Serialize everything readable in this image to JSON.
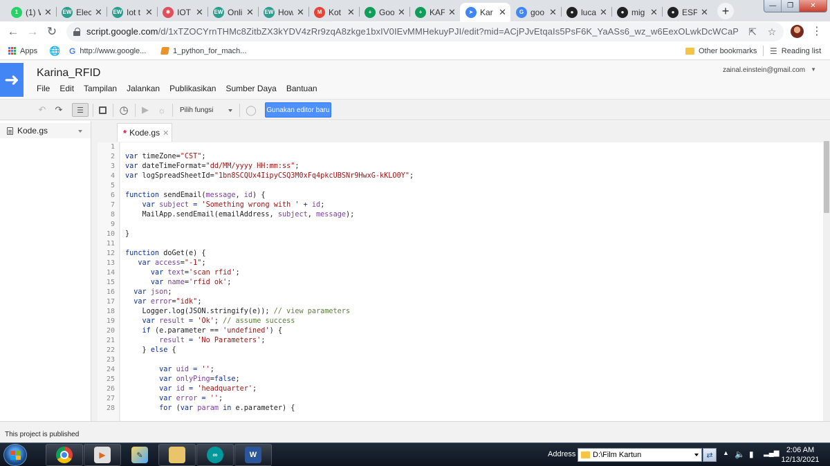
{
  "browser": {
    "tabs": [
      {
        "label": "(1) W",
        "favicon": "whatsapp-icon",
        "favtext": "1",
        "color": "#25d366"
      },
      {
        "label": "Elec",
        "favicon": "ew-icon",
        "favtext": "EW",
        "color": "#2e9e8f"
      },
      {
        "label": "Iot t",
        "favicon": "ew-icon",
        "favtext": "EW",
        "color": "#2e9e8f"
      },
      {
        "label": "IOT",
        "favicon": "iot-icon",
        "favtext": "✱",
        "color": "#e0505a"
      },
      {
        "label": "Onli",
        "favicon": "ew-icon",
        "favtext": "EW",
        "color": "#2e9e8f"
      },
      {
        "label": "How",
        "favicon": "ew-icon",
        "favtext": "EW",
        "color": "#2e9e8f"
      },
      {
        "label": "Kot",
        "favicon": "gmail-icon",
        "favtext": "M",
        "color": "#ea4335"
      },
      {
        "label": "Goo",
        "favicon": "sheets-icon",
        "favtext": "+",
        "color": "#0f9d58"
      },
      {
        "label": "KAF",
        "favicon": "sheets-icon",
        "favtext": "+",
        "color": "#0f9d58"
      },
      {
        "label": "Kar",
        "favicon": "apps-script-icon",
        "favtext": "➤",
        "color": "#4285f4"
      },
      {
        "label": "goo",
        "favicon": "google-icon",
        "favtext": "G",
        "color": "#4285f4"
      },
      {
        "label": "luca",
        "favicon": "github-icon",
        "favtext": "●",
        "color": "#222222"
      },
      {
        "label": "mig",
        "favicon": "github-icon",
        "favtext": "●",
        "color": "#222222"
      },
      {
        "label": "ESP",
        "favicon": "github-icon",
        "favtext": "●",
        "color": "#222222"
      }
    ],
    "active_tab": 9,
    "url_host": "script.google.com",
    "url_path": "/d/1xTZOCYrnTHMc8ZitbZX3kYDV4zRr9zqA8zkge1bxIV0IEvMMHekuyPJI/edit?mid=ACjPJvEtqaIs5PsF6K_YaASs6_wz_w6EexOLwkDcWCaPTqa_4Jo9XnTdYMF1...",
    "bookmarks": {
      "apps": "Apps",
      "google_url": "http://www.google...",
      "python": "1_python_for_mach...",
      "other": "Other bookmarks",
      "reading": "Reading list"
    }
  },
  "editor": {
    "project_title": "Karina_RFID",
    "account": "zainal.einstein@gmail.com",
    "menu": [
      "File",
      "Edit",
      "Tampilan",
      "Jalankan",
      "Publikasikan",
      "Sumber Daya",
      "Bantuan"
    ],
    "function_select": "Pilih fungsi",
    "new_editor_button": "Gunakan editor baru",
    "file_name": "Kode.gs",
    "tab_name": "Kode.gs",
    "status": "This project is published",
    "code_lines": [
      [],
      [
        [
          "k",
          "var "
        ],
        [
          "",
          "timeZone="
        ],
        [
          "s",
          "\"CST\""
        ],
        [
          "",
          ";"
        ]
      ],
      [
        [
          "k",
          "var "
        ],
        [
          "",
          "dateTimeFormat="
        ],
        [
          "s",
          "\"dd/MM/yyyy HH:mm:ss\""
        ],
        [
          "",
          ";"
        ]
      ],
      [
        [
          "k",
          "var "
        ],
        [
          "",
          "logSpreadSheetId="
        ],
        [
          "s",
          "\"1bn8SCQUx4IipyCSQ3M0xFq4pkcUBSNr9HwxG-kKLO0Y\""
        ],
        [
          "",
          ";"
        ]
      ],
      [],
      [
        [
          "k",
          "function "
        ],
        [
          "",
          "sendEmail("
        ],
        [
          "v",
          "message"
        ],
        [
          "",
          ", "
        ],
        [
          "v",
          "id"
        ],
        [
          "",
          ") {"
        ]
      ],
      [
        [
          "",
          "    "
        ],
        [
          "k",
          "var "
        ],
        [
          "v",
          "subject"
        ],
        [
          "k",
          " = "
        ],
        [
          "s",
          "'Something wrong with '"
        ],
        [
          "k",
          " + "
        ],
        [
          "v",
          "id"
        ],
        [
          "",
          ";"
        ]
      ],
      [
        [
          "",
          "    MailApp.sendEmail(emailAddress, "
        ],
        [
          "v",
          "subject"
        ],
        [
          "",
          ", "
        ],
        [
          "v",
          "message"
        ],
        [
          "",
          ");"
        ]
      ],
      [],
      [
        [
          "",
          "}"
        ]
      ],
      [],
      [
        [
          "k",
          "function "
        ],
        [
          "",
          "doGet(e) {"
        ]
      ],
      [
        [
          "",
          "   "
        ],
        [
          "k",
          "var "
        ],
        [
          "v",
          "access"
        ],
        [
          "",
          "="
        ],
        [
          "s",
          "\"-1\""
        ],
        [
          "",
          ";"
        ]
      ],
      [
        [
          "",
          "      "
        ],
        [
          "k",
          "var "
        ],
        [
          "v",
          "text"
        ],
        [
          "",
          "="
        ],
        [
          "s",
          "'scan rfid'"
        ],
        [
          "",
          ";"
        ]
      ],
      [
        [
          "",
          "      "
        ],
        [
          "k",
          "var "
        ],
        [
          "v",
          "name"
        ],
        [
          "",
          "="
        ],
        [
          "s",
          "'rfid ok'"
        ],
        [
          "",
          ";"
        ]
      ],
      [
        [
          "",
          "  "
        ],
        [
          "k",
          "var "
        ],
        [
          "v",
          "json"
        ],
        [
          "",
          ";"
        ]
      ],
      [
        [
          "",
          "  "
        ],
        [
          "k",
          "var "
        ],
        [
          "v",
          "error"
        ],
        [
          "",
          "="
        ],
        [
          "s",
          "\"idk\""
        ],
        [
          "",
          ";"
        ]
      ],
      [
        [
          "",
          "    Logger.log(JSON.stringify(e)); "
        ],
        [
          "c",
          "// view parameters"
        ]
      ],
      [
        [
          "",
          "    "
        ],
        [
          "k",
          "var "
        ],
        [
          "v",
          "result"
        ],
        [
          "k",
          " = "
        ],
        [
          "s",
          "'Ok'"
        ],
        [
          "",
          "; "
        ],
        [
          "c",
          "// assume success"
        ]
      ],
      [
        [
          "",
          "    "
        ],
        [
          "k",
          "if "
        ],
        [
          "",
          "(e.parameter == "
        ],
        [
          "s",
          "'undefined'"
        ],
        [
          "",
          ") {"
        ]
      ],
      [
        [
          "",
          "        "
        ],
        [
          "v",
          "result"
        ],
        [
          "k",
          " = "
        ],
        [
          "s",
          "'No Parameters'"
        ],
        [
          "",
          ";"
        ]
      ],
      [
        [
          "",
          "    } "
        ],
        [
          "k",
          "else "
        ],
        [
          "",
          "{"
        ]
      ],
      [],
      [
        [
          "",
          "        "
        ],
        [
          "k",
          "var "
        ],
        [
          "v",
          "uid"
        ],
        [
          "k",
          " = "
        ],
        [
          "s",
          "''"
        ],
        [
          "",
          ";"
        ]
      ],
      [
        [
          "",
          "        "
        ],
        [
          "k",
          "var "
        ],
        [
          "v",
          "onlyPing"
        ],
        [
          "",
          "="
        ],
        [
          "k",
          "false"
        ],
        [
          "",
          ";"
        ]
      ],
      [
        [
          "",
          "        "
        ],
        [
          "k",
          "var "
        ],
        [
          "v",
          "id"
        ],
        [
          "k",
          " = "
        ],
        [
          "s",
          "'headquarter'"
        ],
        [
          "",
          ";"
        ]
      ],
      [
        [
          "",
          "        "
        ],
        [
          "k",
          "var "
        ],
        [
          "v",
          "error"
        ],
        [
          "k",
          " = "
        ],
        [
          "s",
          "''"
        ],
        [
          "",
          ";"
        ]
      ],
      [
        [
          "",
          "        "
        ],
        [
          "k",
          "for "
        ],
        [
          "",
          "("
        ],
        [
          "k",
          "var "
        ],
        [
          "v",
          "param"
        ],
        [
          "k",
          " in "
        ],
        [
          "",
          "e.parameter) {"
        ]
      ]
    ]
  },
  "taskbar": {
    "address_label": "Address",
    "address_value": "D:\\Film Kartun",
    "time": "2:06 AM",
    "date": "12/13/2021"
  }
}
